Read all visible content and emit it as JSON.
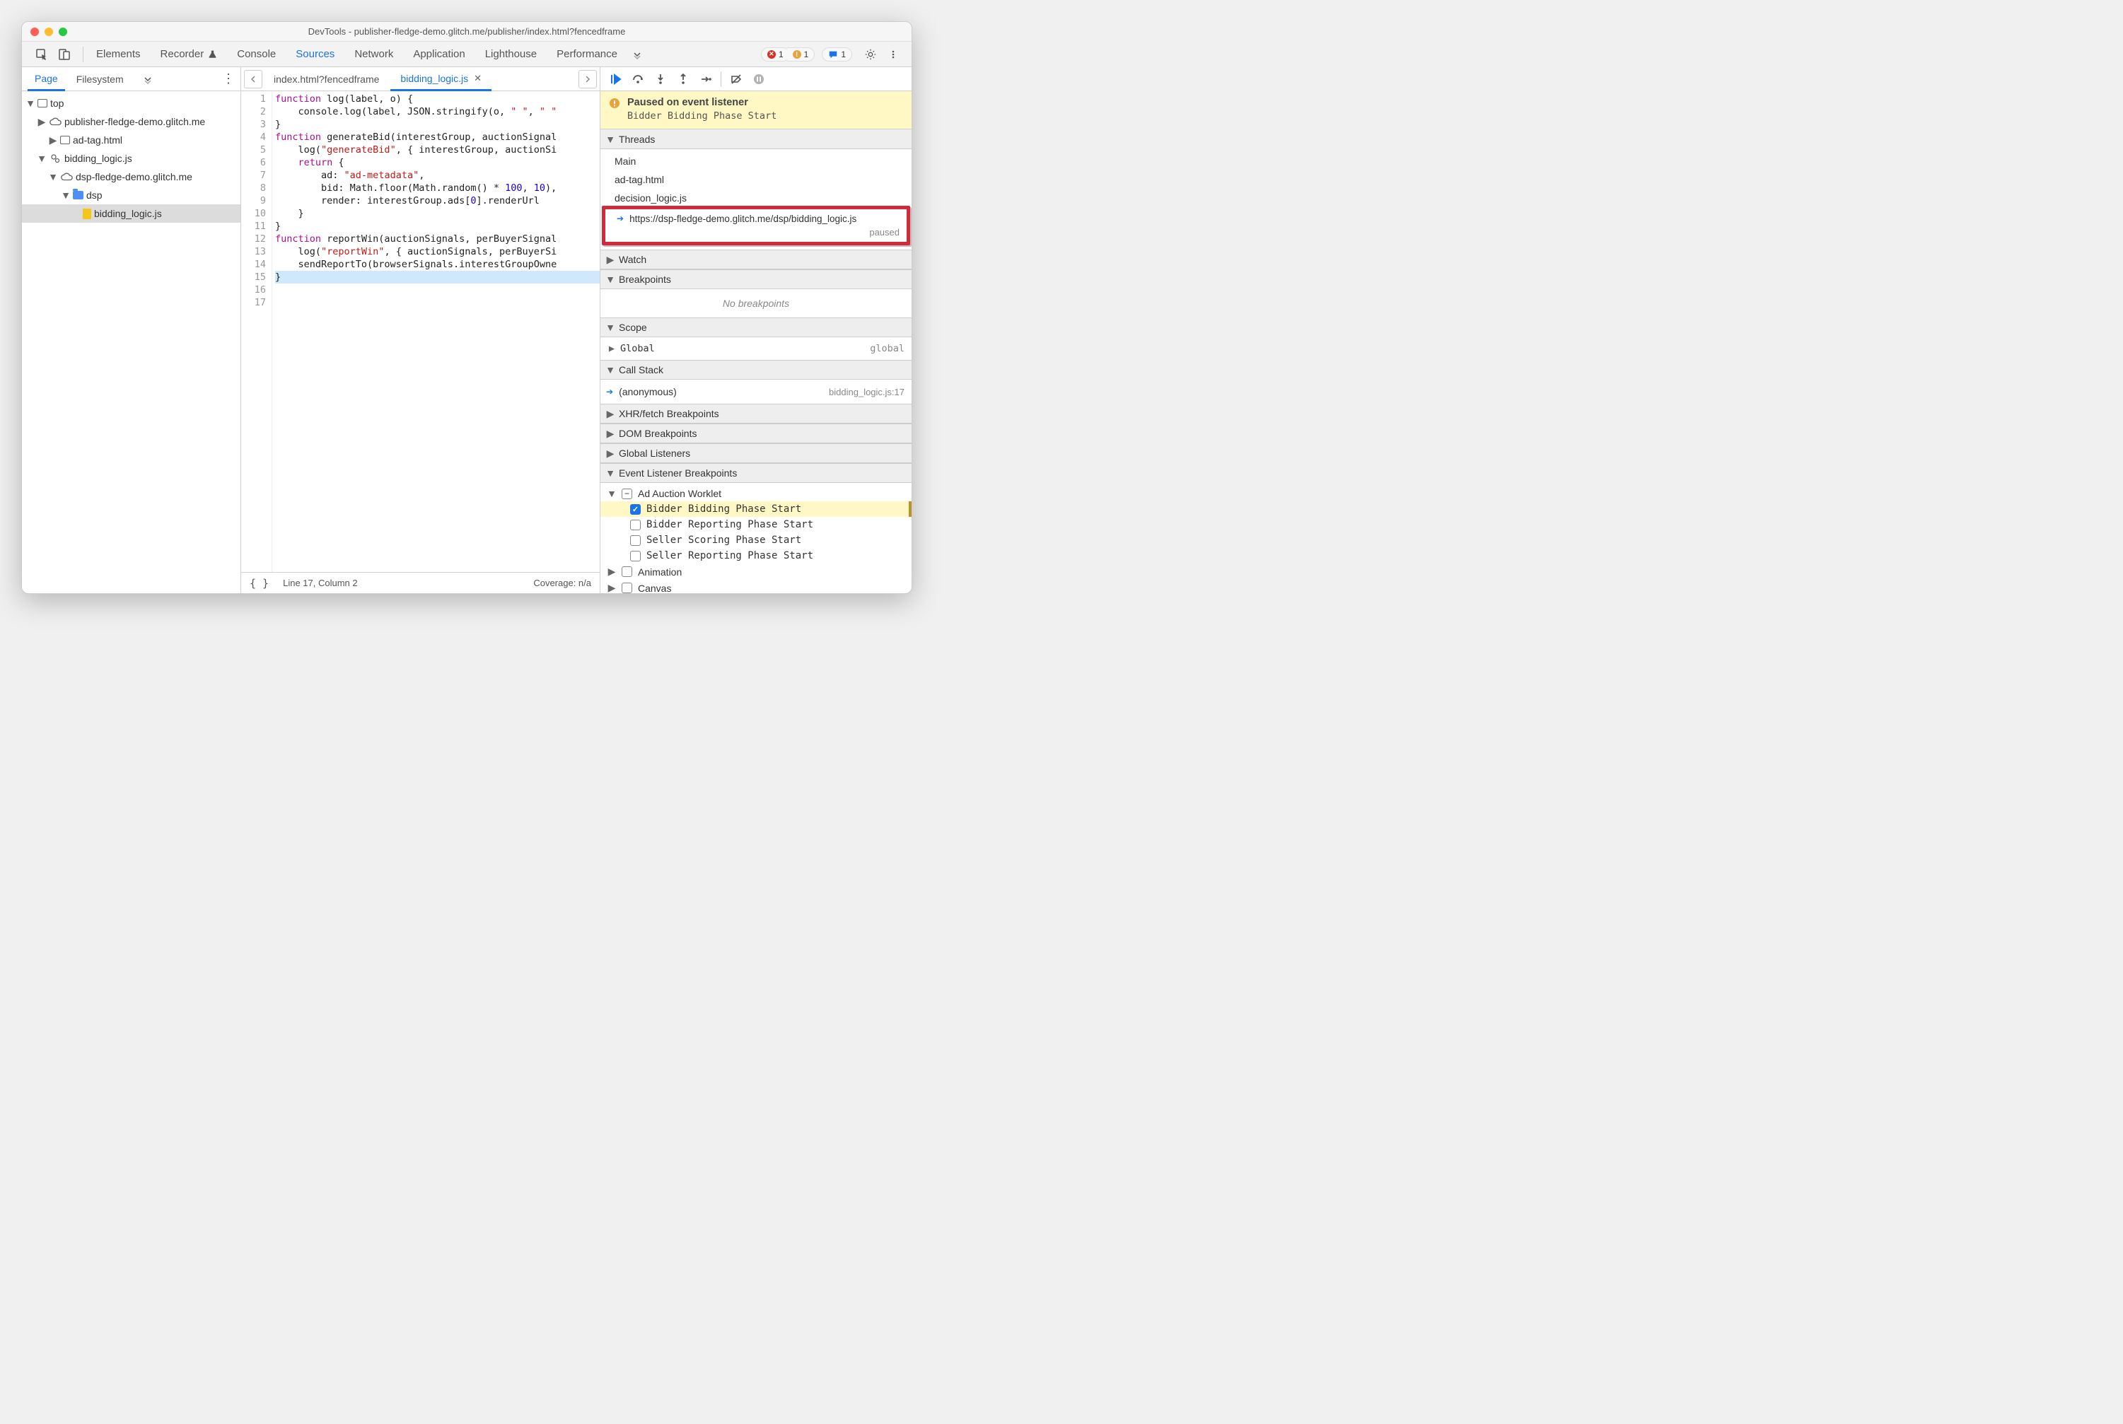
{
  "window": {
    "title": "DevTools - publisher-fledge-demo.glitch.me/publisher/index.html?fencedframe"
  },
  "mainTabs": {
    "items": [
      "Elements",
      "Recorder",
      "Console",
      "Sources",
      "Network",
      "Application",
      "Lighthouse",
      "Performance"
    ],
    "active": "Sources",
    "errorsCount": "1",
    "warningsCount": "1",
    "issuesCount": "1"
  },
  "navigator": {
    "tabs": [
      "Page",
      "Filesystem"
    ],
    "active": "Page",
    "tree": {
      "top": "top",
      "origin1": "publisher-fledge-demo.glitch.me",
      "adTag": "ad-tag.html",
      "worklet": "bidding_logic.js",
      "origin2": "dsp-fledge-demo.glitch.me",
      "folder": "dsp",
      "file": "bidding_logic.js"
    }
  },
  "editor": {
    "tabs": [
      {
        "label": "index.html?fencedframe",
        "active": false
      },
      {
        "label": "bidding_logic.js",
        "active": true,
        "closeable": true
      }
    ],
    "status": {
      "pos": "Line 17, Column 2",
      "coverage": "Coverage: n/a"
    },
    "code": {
      "totalLines": 17,
      "lines": [
        "function log(label, o) {",
        "    console.log(label, JSON.stringify(o, \" \", \" \"",
        "}",
        "",
        "function generateBid(interestGroup, auctionSignal",
        "    log(\"generateBid\", { interestGroup, auctionSi",
        "    return {",
        "        ad: \"ad-metadata\",",
        "        bid: Math.floor(Math.random() * 100, 10),",
        "        render: interestGroup.ads[0].renderUrl",
        "    }",
        "}",
        "",
        "function reportWin(auctionSignals, perBuyerSignal",
        "    log(\"reportWin\", { auctionSignals, perBuyerSi",
        "    sendReportTo(browserSignals.interestGroupOwne",
        "}"
      ]
    }
  },
  "debugger": {
    "paused": {
      "title": "Paused on event listener",
      "subtitle": "Bidder Bidding Phase Start"
    },
    "sections": {
      "threads": "Threads",
      "watch": "Watch",
      "breakpoints": "Breakpoints",
      "scope": "Scope",
      "callStack": "Call Stack",
      "xhr": "XHR/fetch Breakpoints",
      "dom": "DOM Breakpoints",
      "globalListeners": "Global Listeners",
      "eventListener": "Event Listener Breakpoints"
    },
    "threads": {
      "items": [
        "Main",
        "ad-tag.html",
        "decision_logic.js"
      ],
      "selected": {
        "url": "https://dsp-fledge-demo.glitch.me/dsp/bidding_logic.js",
        "status": "paused"
      }
    },
    "breakpoints": {
      "empty": "No breakpoints"
    },
    "scope": {
      "global": "Global",
      "globalValue": "global"
    },
    "callStack": {
      "frame": "(anonymous)",
      "location": "bidding_logic.js:17"
    },
    "eventListener": {
      "category": "Ad Auction Worklet",
      "items": [
        {
          "label": "Bidder Bidding Phase Start",
          "checked": true
        },
        {
          "label": "Bidder Reporting Phase Start",
          "checked": false
        },
        {
          "label": "Seller Scoring Phase Start",
          "checked": false
        },
        {
          "label": "Seller Reporting Phase Start",
          "checked": false
        }
      ],
      "moreCategories": [
        "Animation",
        "Canvas"
      ]
    }
  }
}
